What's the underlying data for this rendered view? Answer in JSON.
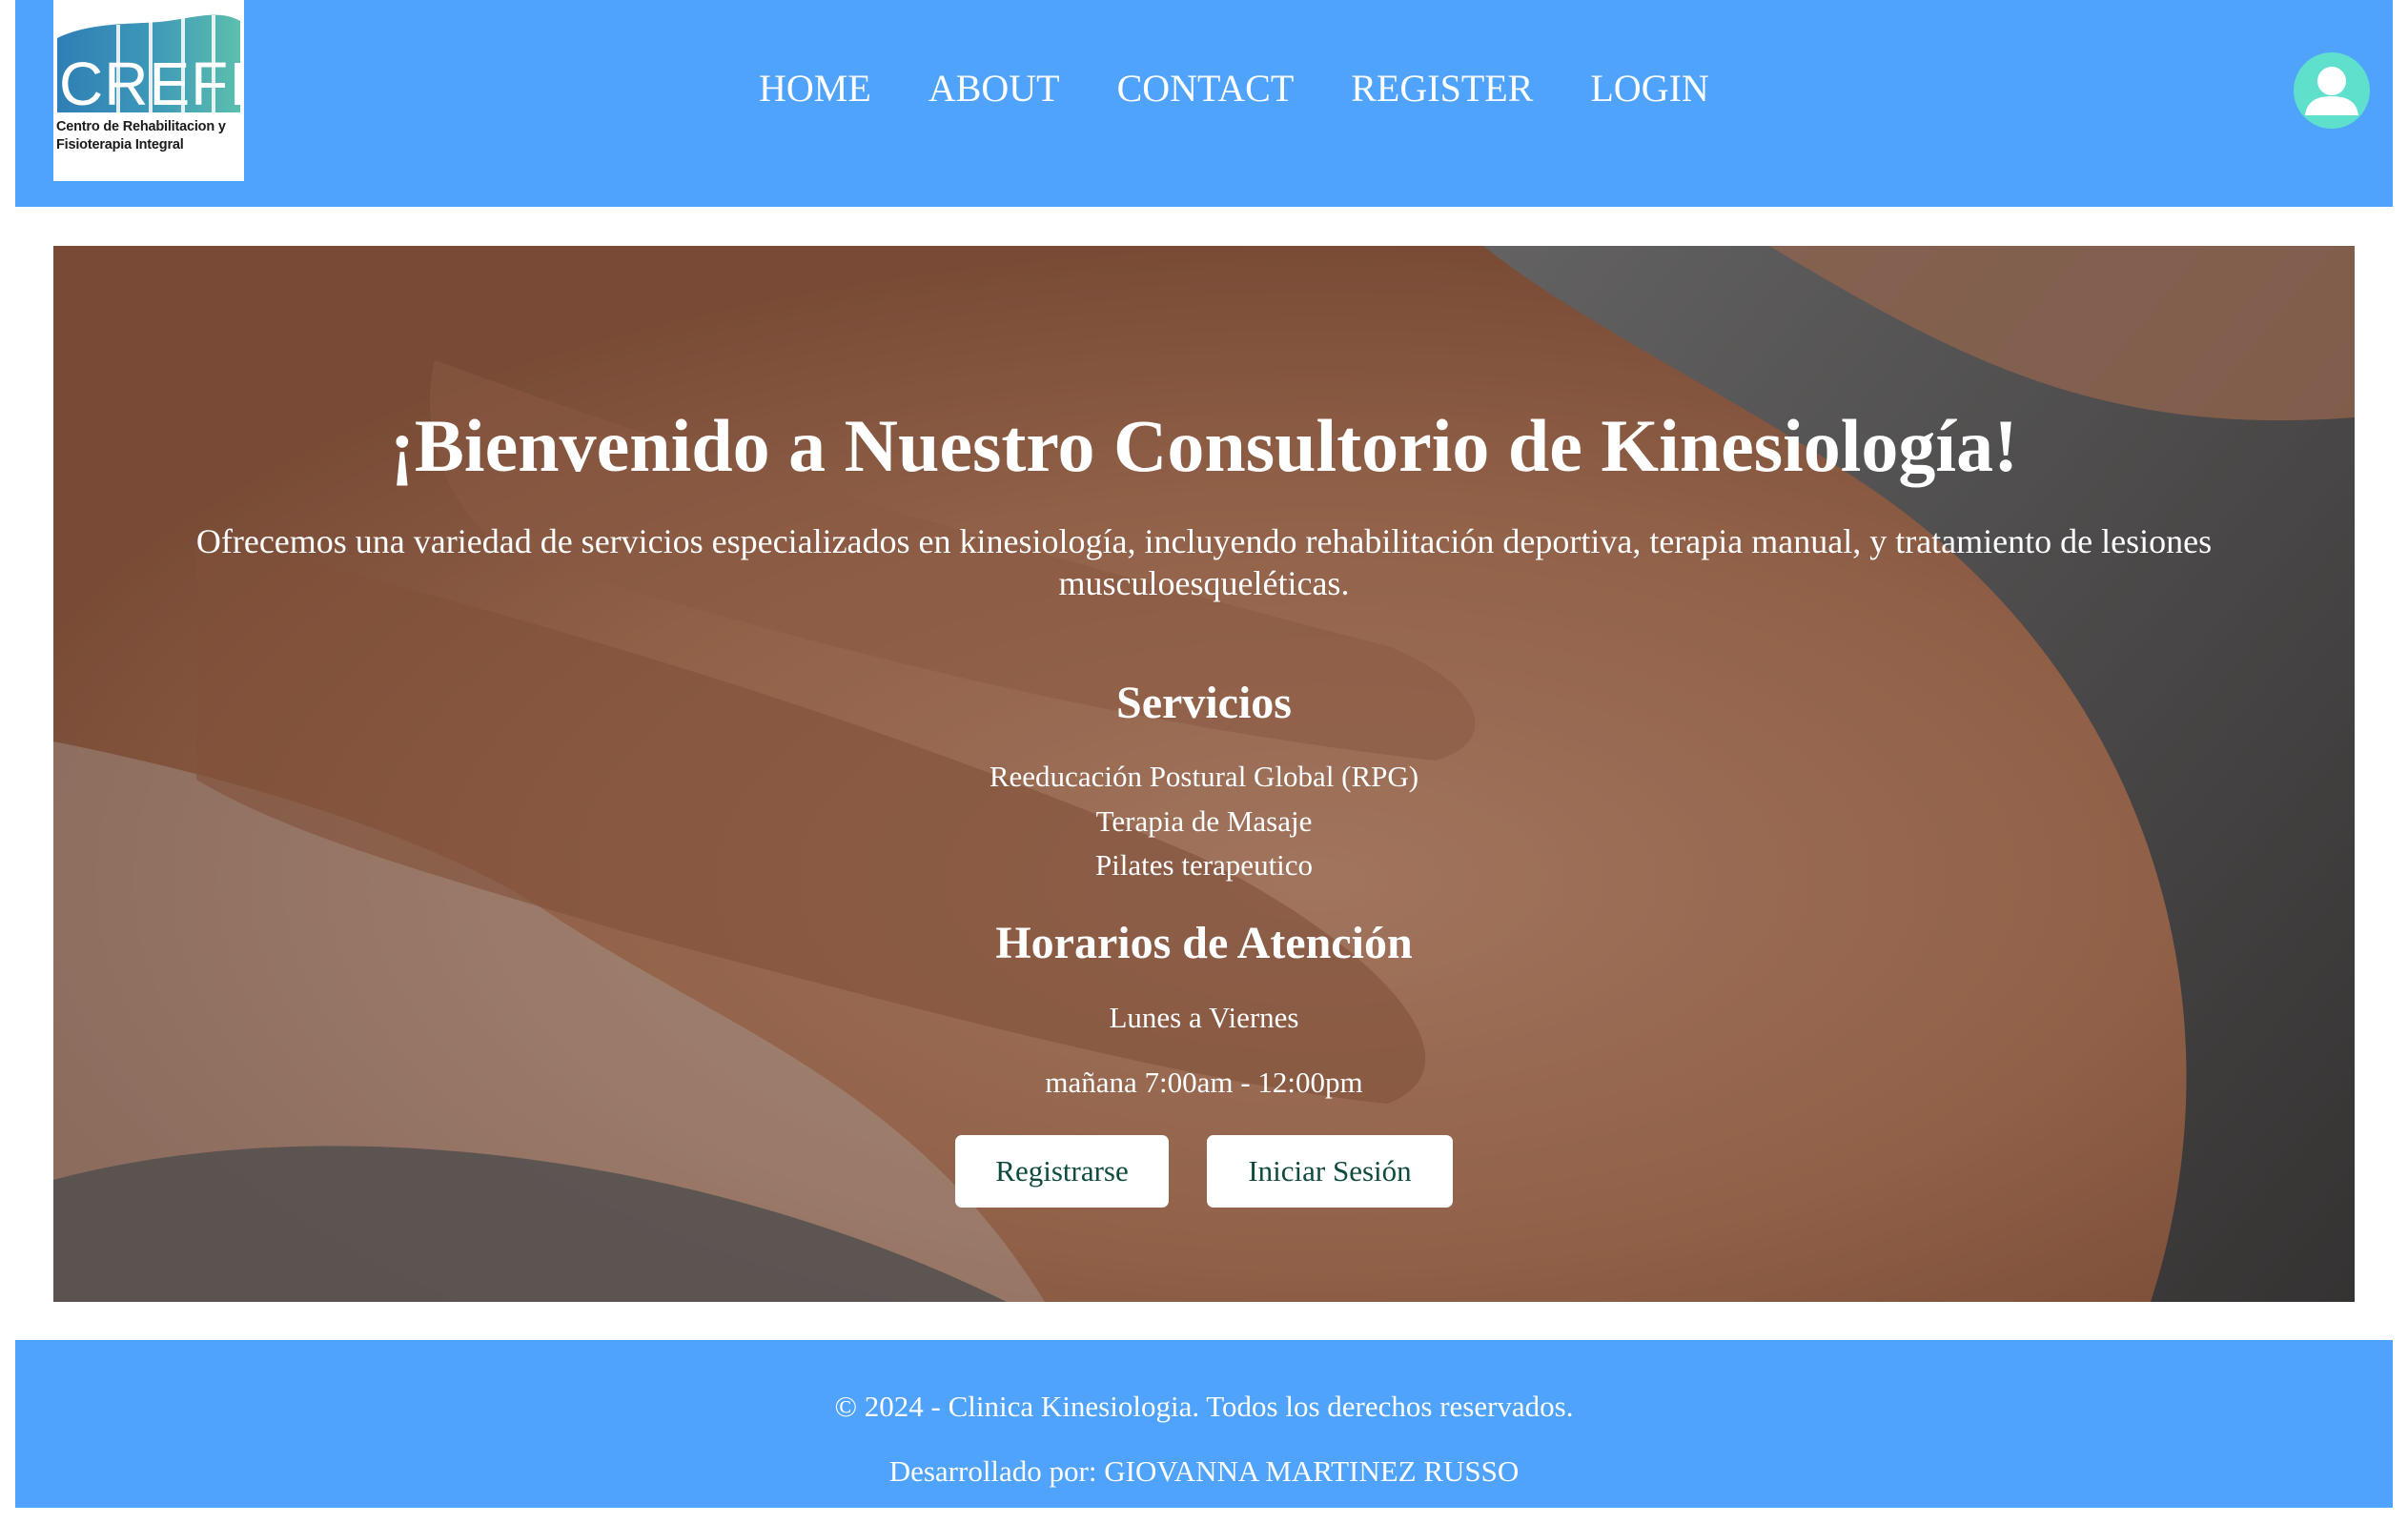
{
  "header": {
    "logo": {
      "brand": "CREFI",
      "subtitle_line1": "Centro de Rehabilitacion y",
      "subtitle_line2": "Fisioterapia Integral"
    },
    "nav": [
      {
        "label": "HOME"
      },
      {
        "label": "ABOUT"
      },
      {
        "label": "CONTACT"
      },
      {
        "label": "REGISTER"
      },
      {
        "label": "LOGIN"
      }
    ],
    "user_icon": "user-avatar-icon"
  },
  "hero": {
    "title": "¡Bienvenido a Nuestro Consultorio de Kinesiología!",
    "description": "Ofrecemos una variedad de servicios especializados en kinesiología, incluyendo rehabilitación deportiva, terapia manual, y tratamiento de lesiones musculoesqueléticas.",
    "services_title": "Servicios",
    "services": [
      "Reeducación Postural Global (RPG)",
      "Terapia de Masaje",
      "Pilates terapeutico"
    ],
    "hours_title": "Horarios de Atención",
    "hours_days": "Lunes a Viernes",
    "hours_time": "mañana 7:00am - 12:00pm",
    "register_button": "Registrarse",
    "login_button": "Iniciar Sesión"
  },
  "footer": {
    "copyright": "© 2024 - Clinica Kinesiologia. Todos los derechos reservados.",
    "developer": "Desarrollado por: GIOVANNA MARTINEZ RUSSO"
  },
  "colors": {
    "header_bg": "#4fa3fb",
    "footer_bg": "#4fa3fb",
    "avatar_bg": "#5fe0cc",
    "button_text": "#0f4a3f"
  }
}
